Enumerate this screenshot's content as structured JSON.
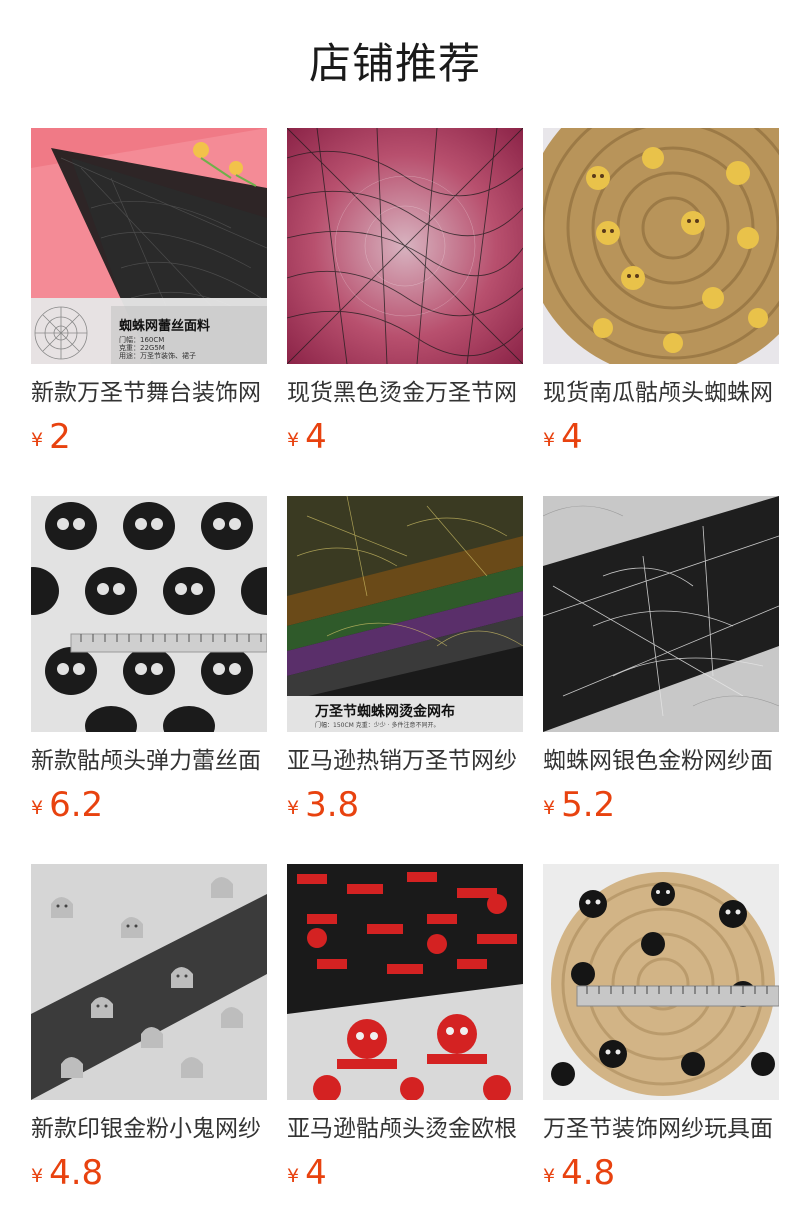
{
  "header": {
    "title": "店铺推荐"
  },
  "colors": {
    "price": "#e8420f",
    "text": "#333333",
    "background": "#ffffff"
  },
  "products": [
    {
      "name": "新款万圣节舞台装饰网",
      "currency": "¥",
      "price": "2",
      "overlay": {
        "title": "蜘蛛网蕾丝面料",
        "line1": "门幅：160CM",
        "line2": "克重：22G5M",
        "line3": "用途：万圣节装饰、裙子"
      }
    },
    {
      "name": "现货黑色烫金万圣节网",
      "currency": "¥",
      "price": "4"
    },
    {
      "name": "现货南瓜骷颅头蜘蛛网",
      "currency": "¥",
      "price": "4"
    },
    {
      "name": "新款骷颅头弹力蕾丝面",
      "currency": "¥",
      "price": "6.2"
    },
    {
      "name": "亚马逊热销万圣节网纱",
      "currency": "¥",
      "price": "3.8",
      "overlay": {
        "title": "万圣节蜘蛛网烫金网布",
        "line1": "门幅：150CM   克重：少少 · 多件注意不同开。"
      }
    },
    {
      "name": "蜘蛛网银色金粉网纱面",
      "currency": "¥",
      "price": "5.2"
    },
    {
      "name": "新款印银金粉小鬼网纱",
      "currency": "¥",
      "price": "4.8"
    },
    {
      "name": "亚马逊骷颅头烫金欧根",
      "currency": "¥",
      "price": "4"
    },
    {
      "name": "万圣节装饰网纱玩具面",
      "currency": "¥",
      "price": "4.8"
    }
  ]
}
